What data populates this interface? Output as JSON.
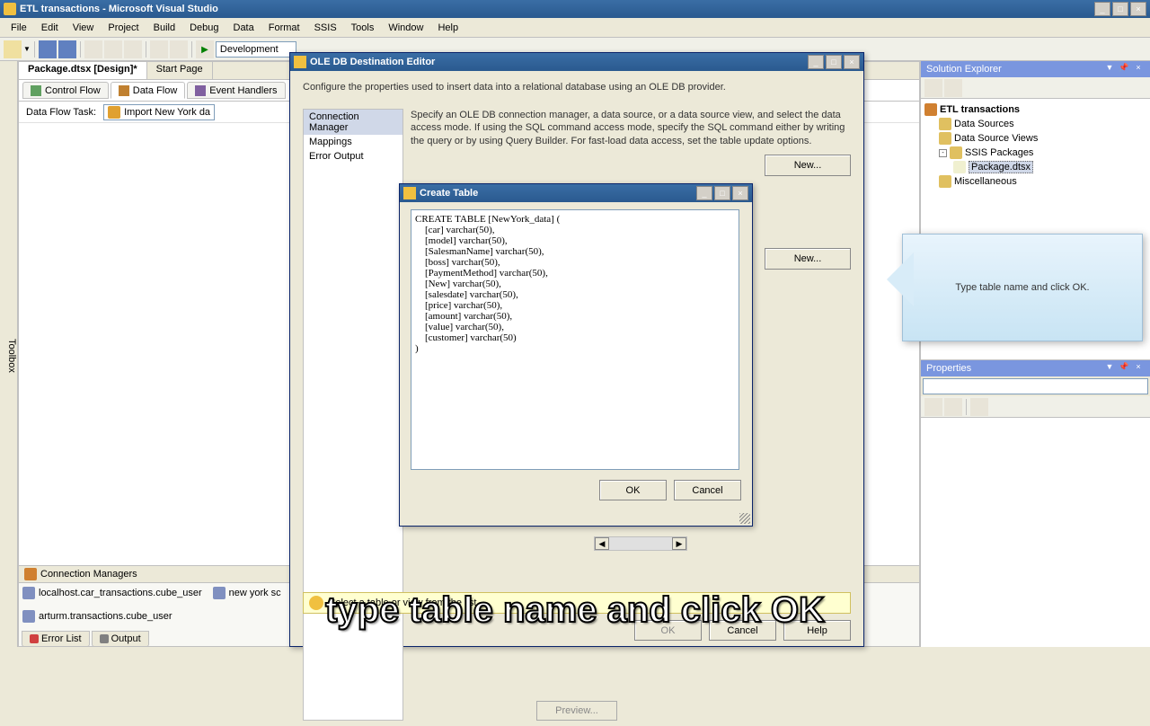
{
  "app": {
    "title": "ETL transactions - Microsoft Visual Studio"
  },
  "menu": [
    "File",
    "Edit",
    "View",
    "Project",
    "Build",
    "Debug",
    "Data",
    "Format",
    "SSIS",
    "Tools",
    "Window",
    "Help"
  ],
  "toolbar": {
    "config": "Development"
  },
  "docs": {
    "tab1": "Package.dtsx [Design]*",
    "tab2": "Start Page"
  },
  "designTabs": {
    "controlFlow": "Control Flow",
    "dataFlow": "Data Flow",
    "eventHandlers": "Event Handlers"
  },
  "flowTask": {
    "label": "Data Flow Task:",
    "value": "Import New York da"
  },
  "connMgr": {
    "header": "Connection Managers",
    "items": [
      "localhost.car_transactions.cube_user",
      "new york sc",
      "arturm.transactions.cube_user"
    ]
  },
  "bottomTabs": {
    "errorList": "Error List",
    "output": "Output"
  },
  "solution": {
    "header": "Solution Explorer",
    "root": "ETL transactions",
    "dataSources": "Data Sources",
    "dataSourceViews": "Data Source Views",
    "ssisPackages": "SSIS Packages",
    "package": "Package.dtsx",
    "misc": "Miscellaneous"
  },
  "properties": {
    "header": "Properties"
  },
  "oledb": {
    "title": "OLE DB Destination Editor",
    "description": "Configure the properties used to insert data into a relational database using an OLE DB provider.",
    "side": {
      "connManager": "Connection Manager",
      "mappings": "Mappings",
      "errorOutput": "Error Output"
    },
    "instruction": "Specify an OLE DB connection manager, a data source, or a data source view, and select the data access mode. If using the SQL command access mode, specify the SQL command either by writing the query or by using Query Builder. For fast-load data access, set the table update options.",
    "newBtn": "New...",
    "previewBtn": "Preview...",
    "warning": "Select a table or view from the list.",
    "ok": "OK",
    "cancel": "Cancel",
    "help": "Help"
  },
  "createTable": {
    "title": "Create Table",
    "sql": "CREATE TABLE [NewYork_data] (\n    [car] varchar(50),\n    [model] varchar(50),\n    [SalesmanName] varchar(50),\n    [boss] varchar(50),\n    [PaymentMethod] varchar(50),\n    [New] varchar(50),\n    [salesdate] varchar(50),\n    [price] varchar(50),\n    [amount] varchar(50),\n    [value] varchar(50),\n    [customer] varchar(50)\n)",
    "ok": "OK",
    "cancel": "Cancel"
  },
  "callout": {
    "text": "Type table name and click OK."
  },
  "subtitle": {
    "text": "type table name and click OK"
  },
  "toolbox": {
    "label": "Toolbox"
  }
}
